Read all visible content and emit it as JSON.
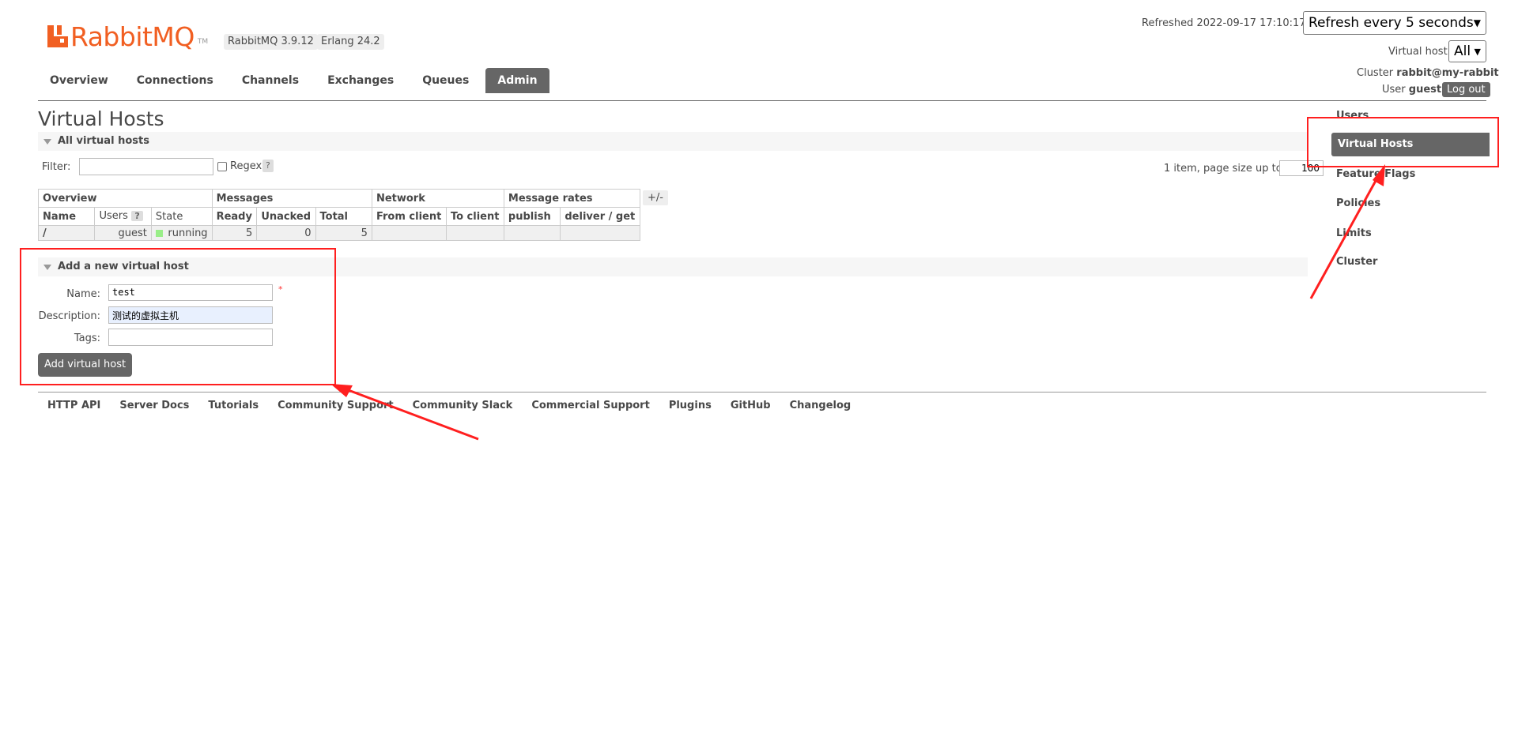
{
  "header": {
    "logo_text": "RabbitMQ",
    "logo_tm": "TM",
    "version_badge": "RabbitMQ 3.9.12",
    "erlang_badge": "Erlang 24.2",
    "refreshed_text": "Refreshed 2022-09-17 17:10:17",
    "refresh_select": "Refresh every 5 seconds",
    "vhost_label": "Virtual host",
    "vhost_select": "All",
    "cluster_label": "Cluster",
    "cluster_value": "rabbit@my-rabbit",
    "user_label": "User",
    "user_value": "guest",
    "logout_label": "Log out"
  },
  "nav": {
    "items": [
      "Overview",
      "Connections",
      "Channels",
      "Exchanges",
      "Queues",
      "Admin"
    ],
    "active": "Admin"
  },
  "side_menu": {
    "items": [
      "Users",
      "Virtual Hosts",
      "Feature Flags",
      "Policies",
      "Limits",
      "Cluster"
    ],
    "active": "Virtual Hosts"
  },
  "page": {
    "title": "Virtual Hosts",
    "section_all": "All virtual hosts",
    "filter_label": "Filter:",
    "filter_value": "",
    "regex_label": "Regex",
    "help_mark": "?",
    "pagination_text": "1 item, page size up to",
    "page_size": "100",
    "plus_minus": "+/-"
  },
  "table": {
    "groups": [
      "Overview",
      "Messages",
      "Network",
      "Message rates"
    ],
    "columns": [
      "Name",
      "Users",
      "State",
      "Ready",
      "Unacked",
      "Total",
      "From client",
      "To client",
      "publish",
      "deliver / get"
    ],
    "rows": [
      {
        "name": "/",
        "users": "guest",
        "state": "running",
        "ready": "5",
        "unacked": "0",
        "total": "5",
        "from_client": "",
        "to_client": "",
        "publish": "",
        "deliver_get": ""
      }
    ]
  },
  "add_form": {
    "title": "Add a new virtual host",
    "name_label": "Name:",
    "name_value": "test",
    "required_mark": "*",
    "description_label": "Description:",
    "description_value": "测试的虚拟主机",
    "tags_label": "Tags:",
    "tags_value": "",
    "submit_label": "Add virtual host"
  },
  "footer": {
    "links": [
      "HTTP API",
      "Server Docs",
      "Tutorials",
      "Community Support",
      "Community Slack",
      "Commercial Support",
      "Plugins",
      "GitHub",
      "Changelog"
    ]
  },
  "colors": {
    "brand_orange": "#f15f22",
    "nav_active_bg": "#666666",
    "annotation_red": "#ff1f1f",
    "running_green": "#99ee88"
  }
}
